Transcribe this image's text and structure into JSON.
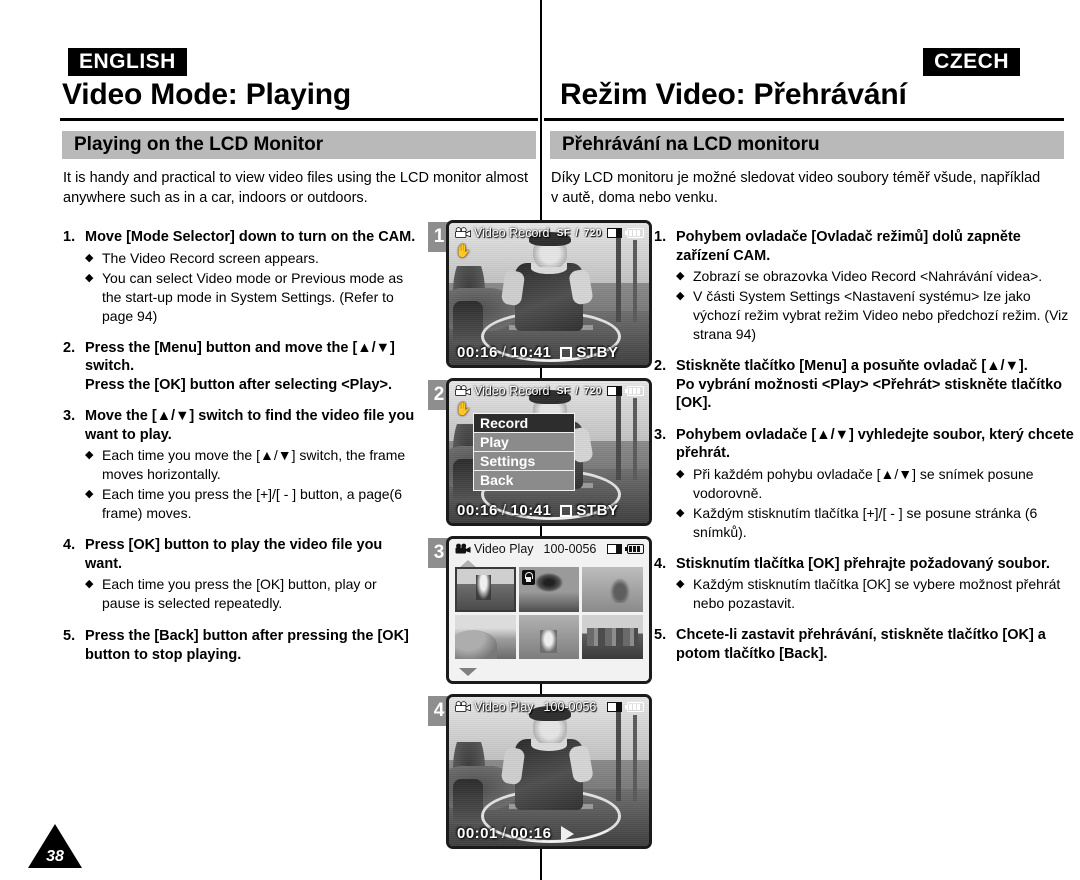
{
  "english": {
    "lang_tag": "ENGLISH",
    "chapter_title": "Video Mode: Playing",
    "section_title": "Playing on the LCD Monitor",
    "intro": "It is handy and practical to view video files using the LCD monitor almost anywhere such as in a car, indoors or outdoors.",
    "steps": [
      {
        "num": "1.",
        "heads": [
          "Move [Mode Selector] down to turn on the CAM."
        ],
        "bullets": [
          "The Video Record screen appears.",
          "You can select Video mode or Previous mode as the start-up mode in System Settings. (Refer to page 94)"
        ]
      },
      {
        "num": "2.",
        "heads": [
          "Press the [Menu] button and move the [▲/▼] switch.",
          "Press the [OK] button after selecting <Play>."
        ],
        "bullets": []
      },
      {
        "num": "3.",
        "heads": [
          "Move the [▲/▼] switch to find the video file you want to play."
        ],
        "bullets": [
          "Each time you move the [▲/▼] switch, the frame moves horizontally.",
          "Each time you press the [+]/[ - ] button, a page(6 frame) moves."
        ]
      },
      {
        "num": "4.",
        "heads": [
          "Press [OK] button to play the video file you want."
        ],
        "bullets": [
          "Each time you press the [OK] button, play or pause is selected repeatedly."
        ]
      },
      {
        "num": "5.",
        "heads": [
          "Press the [Back] button after pressing the [OK] button to stop playing."
        ],
        "bullets": []
      }
    ]
  },
  "czech": {
    "lang_tag": "CZECH",
    "chapter_title": "Režim Video: Přehrávání",
    "section_title": "Přehrávání na LCD monitoru",
    "intro": "Díky LCD monitoru je možné sledovat video soubory téměř všude, například v autě, doma nebo venku.",
    "steps": [
      {
        "num": "1.",
        "heads": [
          "Pohybem ovladače [Ovladač režimů] dolů zapněte zařízení CAM."
        ],
        "bullets": [
          "Zobrazí se obrazovka Video Record <Nahrávání videa>.",
          "V části System Settings <Nastavení systému> lze jako výchozí režim vybrat režim Video nebo předchozí režim. (Viz strana 94)"
        ]
      },
      {
        "num": "2.",
        "heads": [
          "Stiskněte tlačítko [Menu] a posuňte ovladač [▲/▼].",
          "Po vybrání možnosti <Play> <Přehrát> stiskněte tlačítko [OK]."
        ],
        "bullets": []
      },
      {
        "num": "3.",
        "heads": [
          "Pohybem ovladače [▲/▼] vyhledejte soubor, který chcete přehrát."
        ],
        "bullets": [
          "Při každém pohybu ovladače [▲/▼] se snímek posune vodorovně.",
          "Každým stisknutím tlačítka [+]/[ - ] se posune stránka (6 snímků)."
        ]
      },
      {
        "num": "4.",
        "heads": [
          "Stisknutím tlačítka [OK] přehrajte požadovaný soubor."
        ],
        "bullets": [
          "Každým stisknutím tlačítka [OK] se vybere možnost přehrát nebo pozastavit."
        ]
      },
      {
        "num": "5.",
        "heads": [
          "Chcete-li zastavit přehrávání, stiskněte tlačítko [OK] a potom tlačítko [Back]."
        ],
        "bullets": []
      }
    ]
  },
  "panels": [
    {
      "badge": "1",
      "osd_title": "Video Record",
      "quality": "SF",
      "quality_sep": "/",
      "resolution": "720",
      "time_current": "00:16",
      "time_sep": "/",
      "time_total": "10:41",
      "status": "STBY"
    },
    {
      "badge": "2",
      "osd_title": "Video Record",
      "quality": "SF",
      "quality_sep": "/",
      "resolution": "720",
      "time_current": "00:16",
      "time_sep": "/",
      "time_total": "10:41",
      "status": "STBY",
      "menu": [
        {
          "label": "Record",
          "selected": true
        },
        {
          "label": "Play",
          "selected": false
        },
        {
          "label": "Settings",
          "selected": false
        },
        {
          "label": "Back",
          "selected": false
        }
      ]
    },
    {
      "badge": "3",
      "osd_title": "Video Play",
      "file_number": "100-0056",
      "thumbnails": [
        {
          "name": "kid-thumb",
          "selected": true,
          "locked": false
        },
        {
          "name": "palm-thumb",
          "selected": false,
          "locked": true
        },
        {
          "name": "rabbit-thumb",
          "selected": false,
          "locked": false
        },
        {
          "name": "hill-thumb",
          "selected": false,
          "locked": false
        },
        {
          "name": "crowd-thumb",
          "selected": false,
          "locked": false
        },
        {
          "name": "city-thumb",
          "selected": false,
          "locked": false
        }
      ]
    },
    {
      "badge": "4",
      "osd_title": "Video Play",
      "file_number": "100-0056",
      "time_current": "00:01",
      "time_sep": "/",
      "time_total": "00:16"
    }
  ],
  "footer": {
    "page_number": "38"
  },
  "colors": {
    "section_bar": "#b9b9b9",
    "lang_tag_bg": "#000000",
    "badge_bg": "#8e8e8e",
    "menu_selected": "#2d2d2d",
    "menu_item": "#8b8b8b"
  }
}
